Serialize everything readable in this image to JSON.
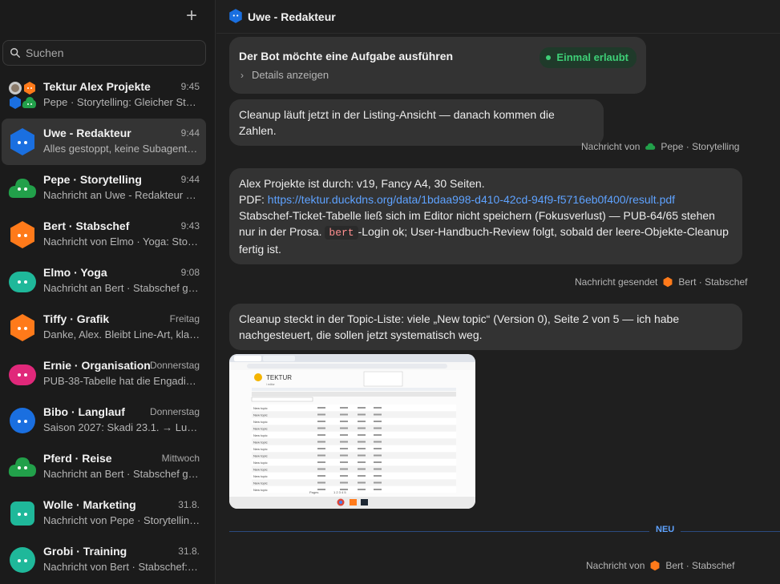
{
  "sidebar": {
    "new_button": "+",
    "search": {
      "placeholder": "Suchen"
    },
    "chats": [
      {
        "name": "Tektur Alex Projekte",
        "time": "9:45",
        "preview": "Pepe · Storytelling: Gleicher Stan…",
        "avatar": "group",
        "color": "#ff7a1a",
        "active": false
      },
      {
        "name": "Uwe - Redakteur",
        "time": "9:44",
        "preview": "Alles gestoppt, keine Subagente…",
        "avatar": "hex",
        "color": "#1a6fe0",
        "active": true
      },
      {
        "name": "Pepe · Storytelling",
        "time": "9:44",
        "preview": "Nachricht an Uwe - Redakteur g…",
        "avatar": "cloud",
        "color": "#22a04a",
        "active": false
      },
      {
        "name": "Bert · Stabschef",
        "time": "9:43",
        "preview": "Nachricht von Elmo · Yoga: Stop…",
        "avatar": "hex",
        "color": "#ff7a1a",
        "active": false
      },
      {
        "name": "Elmo · Yoga",
        "time": "9:08",
        "preview": "Nachricht an Bert · Stabschef ge…",
        "avatar": "pill",
        "color": "#1fb89a",
        "active": false
      },
      {
        "name": "Tiffy · Grafik",
        "time": "Freitag",
        "preview": "Danke, Alex. Bleibt Line-Art, klar…",
        "avatar": "hex",
        "color": "#ff7a1a",
        "active": false
      },
      {
        "name": "Ernie · Organisation",
        "time": "Donnerstag",
        "preview": "PUB-38-Tabelle hat die Engadin…",
        "avatar": "pill",
        "color": "#e0287a",
        "active": false
      },
      {
        "name": "Bibo · Langlauf",
        "time": "Donnerstag",
        "preview": "Saison 2027: Skadi 23.1. → Ludw…",
        "avatar": "blob",
        "color": "#1a6fe0",
        "active": false
      },
      {
        "name": "Pferd · Reise",
        "time": "Mittwoch",
        "preview": "Nachricht an Bert · Stabschef ge…",
        "avatar": "cloud",
        "color": "#22a04a",
        "active": false
      },
      {
        "name": "Wolle · Marketing",
        "time": "31.8.",
        "preview": "Nachricht von Pepe · Storytellin…",
        "avatar": "square",
        "color": "#1fb89a",
        "active": false
      },
      {
        "name": "Grobi · Training",
        "time": "31.8.",
        "preview": "Nachricht von Bert · Stabschef: 0…",
        "avatar": "blob",
        "color": "#1fb89a",
        "active": false
      }
    ]
  },
  "header": {
    "title": "Uwe - Redakteur"
  },
  "messages": {
    "task": {
      "title": "Der Bot möchte eine Aufgabe ausführen",
      "badge": "Einmal erlaubt",
      "details": "Details anzeigen"
    },
    "m1": "Cleanup läuft jetzt in der Listing-Ansicht — danach kommen die Zahlen.",
    "meta1": {
      "prefix": "Nachricht von",
      "who": "Pepe · Storytelling"
    },
    "m2": {
      "line1": "Alex Projekte ist durch: v19, Fancy A4, 30 Seiten.",
      "pdf_label": "PDF: ",
      "pdf_url": "https://tektur.duckdns.org/data/1bdaa998-d410-42cd-94f9-f5716eb0f400/result.pdf",
      "text_a": "Stabschef-Ticket-Tabelle ließ sich im Editor nicht speichern (Fokusverlust) — PUB-64/65 stehen nur in der Prosa. ",
      "code": "bert",
      "text_b": "-Login ok; User-Handbuch-Review folgt, sobald der leere-Objekte-Cleanup fertig ist."
    },
    "meta2": {
      "prefix": "Nachricht gesendet",
      "who": "Bert · Stabschef"
    },
    "m3": "Cleanup steckt in der Topic-Liste: viele „New topic“ (Version 0), Seite 2 von 5 — ich habe nachgesteuert, die sollen jetzt systematisch weg.",
    "screenshot": {
      "brand": "TEKTUR",
      "sub": "/ editor",
      "row_label": "New topic",
      "pager": "Pages",
      "pages": "1 2 3 4 5"
    },
    "separator": "NEU",
    "meta3": {
      "prefix": "Nachricht von",
      "who": "Bert · Stabschef"
    }
  }
}
